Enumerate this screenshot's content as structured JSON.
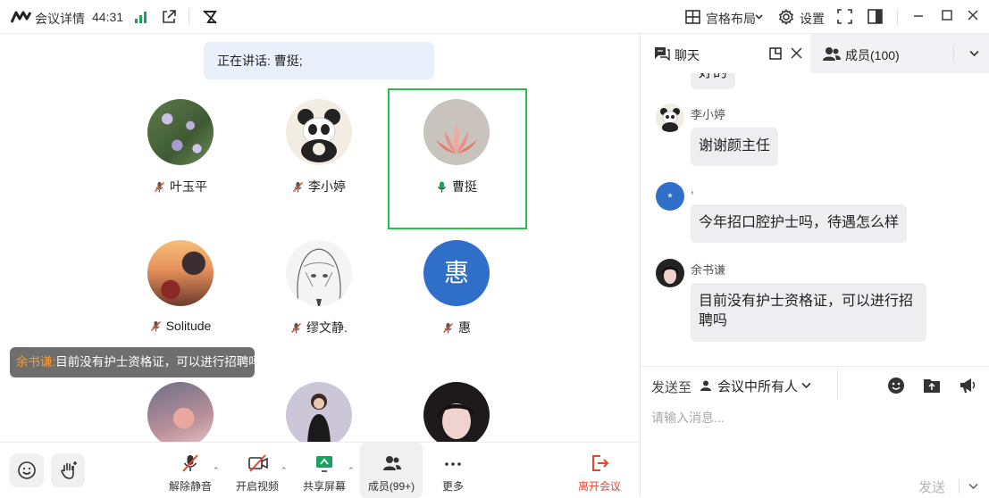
{
  "titlebar": {
    "app_title": "会议详情",
    "timer": "44:31",
    "layout_label": "宫格布局",
    "settings_label": "设置"
  },
  "stage": {
    "speaking_text": "正在讲话: 曹挺;",
    "participants": [
      {
        "name": "叶玉平",
        "mic": "muted"
      },
      {
        "name": "李小婷",
        "mic": "muted"
      },
      {
        "name": "曹挺",
        "mic": "speaking",
        "active": true
      },
      {
        "name": "Solitude",
        "mic": "muted"
      },
      {
        "name": "缪文静.",
        "mic": "muted"
      },
      {
        "name": "惠",
        "mic": "muted",
        "avatar_text": "惠"
      }
    ],
    "floating_chat": {
      "sender": "余书谦:",
      "text": "目前没有护士资格证，可以进行招聘吗"
    }
  },
  "toolbar": {
    "unmute_label": "解除静音",
    "video_label": "开启视频",
    "share_label": "共享屏幕",
    "members_label": "成员(99+)",
    "more_label": "更多",
    "leave_label": "离开会议"
  },
  "panel": {
    "chat_tab": "聊天",
    "members_tab": "成员(100)",
    "messages": [
      {
        "sender": "",
        "text": "好的"
      },
      {
        "sender": "李小婷",
        "text": "谢谢颜主任"
      },
      {
        "sender": ",",
        "text": "今年招口腔护士吗，待遇怎么样",
        "avatar_text": "*"
      },
      {
        "sender": "余书谦",
        "text": "目前没有护士资格证，可以进行招聘吗"
      }
    ],
    "send_to_label": "发送至",
    "recipient": "会议中所有人",
    "input_placeholder": "请输入消息...",
    "send_label": "发送"
  },
  "colors": {
    "active_border": "#26c24c",
    "leave_red": "#e5472d",
    "avatar_blue": "#2f6fca",
    "sender_orange": "#ff9a2e",
    "share_green": "#1aa260"
  }
}
